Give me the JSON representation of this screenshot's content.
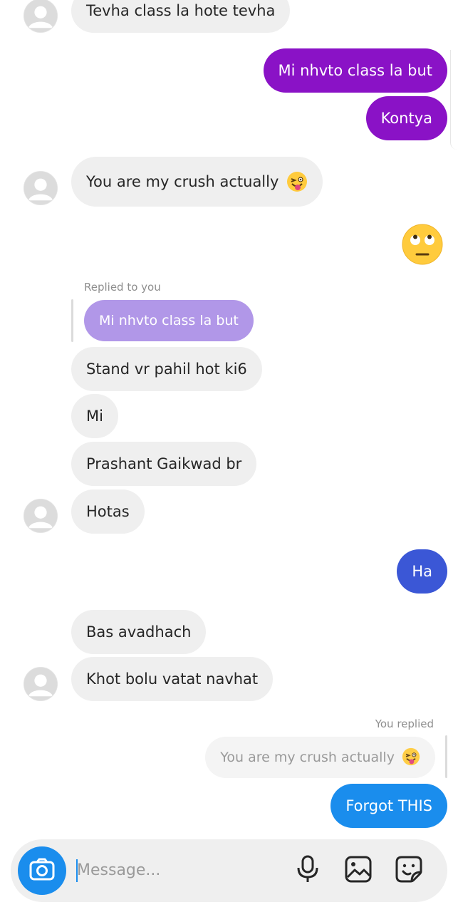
{
  "messages": {
    "m0": "Tevha class la hote tevha",
    "m1": "Mi nhvto class la but",
    "m2": "Kontya",
    "m3": "You are my crush actually",
    "m4_emoji": "🙄",
    "reply_meta_in": "Replied to you",
    "reply_quote_in": "Mi nhvto class la but",
    "m5": "Stand vr pahil hot ki6",
    "m6": "Mi",
    "m7": "Prashant Gaikwad br",
    "m8": "Hotas",
    "m9": "Ha",
    "m10": "Bas avadhach",
    "m11": "Khot bolu vatat navhat",
    "reply_meta_out": "You replied",
    "reply_quote_out": "You are my crush actually",
    "m12": "Forgot THIS",
    "wink_emoji": "😜"
  },
  "composer": {
    "placeholder": "Message...",
    "icons": [
      "camera-icon",
      "microphone-icon",
      "image-icon",
      "sticker-icon"
    ]
  },
  "colors": {
    "incoming": "#efefef",
    "outgoing_purple": "#8a12c6",
    "outgoing_blue": "#3b57d6",
    "outgoing_light_blue": "#1a8ded",
    "faded_quote": "#b197e8"
  }
}
